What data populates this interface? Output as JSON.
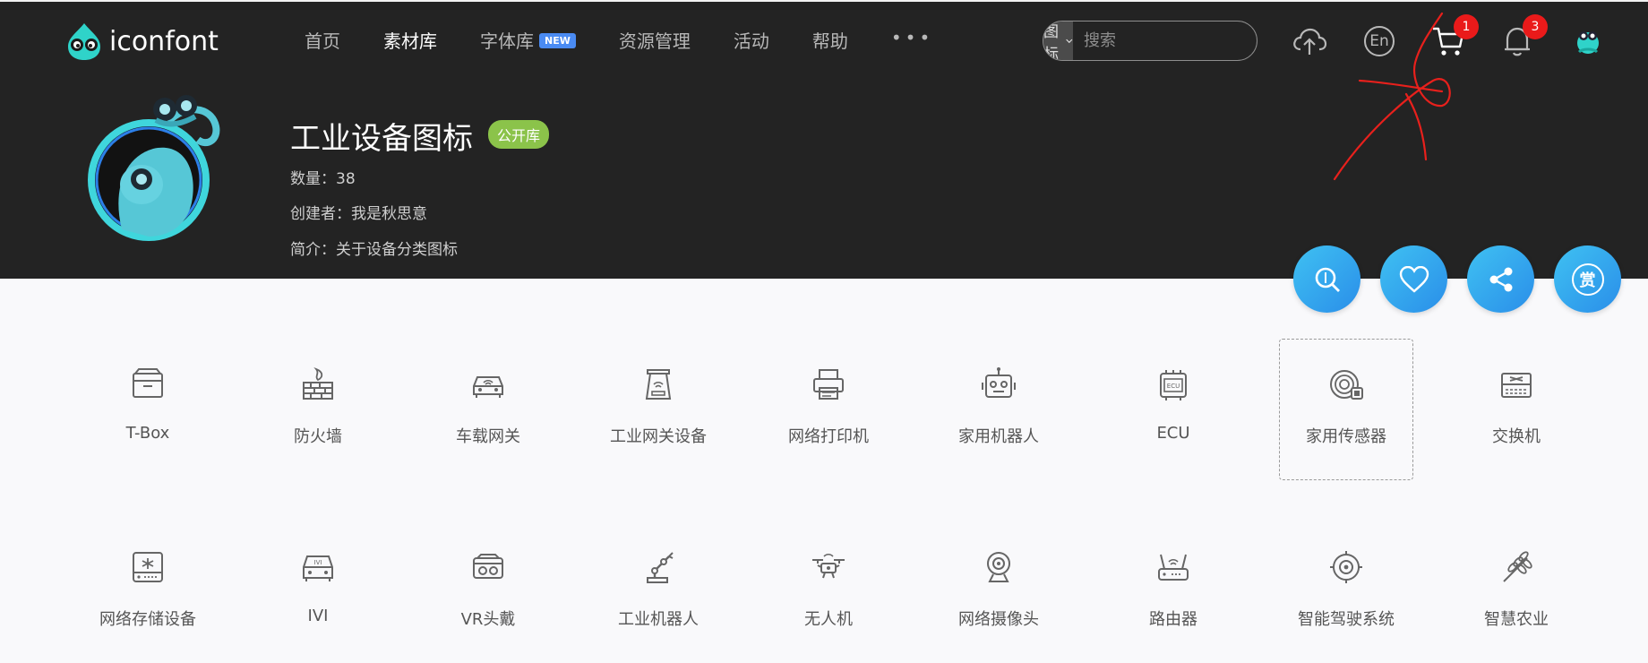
{
  "header": {
    "logo_text": "iconfont",
    "nav": [
      {
        "label": "首页",
        "active": false
      },
      {
        "label": "素材库",
        "active": true
      },
      {
        "label": "字体库",
        "active": false,
        "badge": "NEW"
      },
      {
        "label": "资源管理",
        "active": false
      },
      {
        "label": "活动",
        "active": false
      },
      {
        "label": "帮助",
        "active": false
      }
    ],
    "more_label": "•••",
    "search": {
      "type": "图标",
      "placeholder": "搜索"
    },
    "lang_label": "En",
    "cart_count": "1",
    "notification_count": "3"
  },
  "library": {
    "title": "工业设备图标",
    "tag": "公开库",
    "count_line": "数量：38",
    "creator_line": "创建者：我是秋思意",
    "intro_line": "简介：关于设备分类图标"
  },
  "actions": {
    "reward_label": "赏"
  },
  "colors": {
    "header_bg": "#232323",
    "accent_gradient": [
      "#3fc1f2",
      "#2a8ee9"
    ],
    "tag_green": "#8bc34a",
    "badge_red": "#ea1a1a",
    "annotation_red": "#e8201c"
  },
  "icons": [
    {
      "label": "T-Box",
      "icon": "tbox-icon"
    },
    {
      "label": "防火墙",
      "icon": "firewall-icon"
    },
    {
      "label": "车载网关",
      "icon": "car-gateway-icon"
    },
    {
      "label": "工业网关设备",
      "icon": "industrial-gateway-icon"
    },
    {
      "label": "网络打印机",
      "icon": "network-printer-icon"
    },
    {
      "label": "家用机器人",
      "icon": "home-robot-icon"
    },
    {
      "label": "ECU",
      "icon": "ecu-icon"
    },
    {
      "label": "家用传感器",
      "icon": "home-sensor-icon",
      "hover": true
    },
    {
      "label": "交换机",
      "icon": "switch-icon"
    },
    {
      "label": "网络存储设备",
      "icon": "network-storage-icon"
    },
    {
      "label": "IVI",
      "icon": "ivi-icon"
    },
    {
      "label": "VR头戴",
      "icon": "vr-headset-icon"
    },
    {
      "label": "工业机器人",
      "icon": "industrial-robot-icon"
    },
    {
      "label": "无人机",
      "icon": "drone-icon"
    },
    {
      "label": "网络摄像头",
      "icon": "webcam-icon"
    },
    {
      "label": "路由器",
      "icon": "router-icon"
    },
    {
      "label": "智能驾驶系统",
      "icon": "smart-driving-icon"
    },
    {
      "label": "智慧农业",
      "icon": "smart-agriculture-icon"
    }
  ]
}
